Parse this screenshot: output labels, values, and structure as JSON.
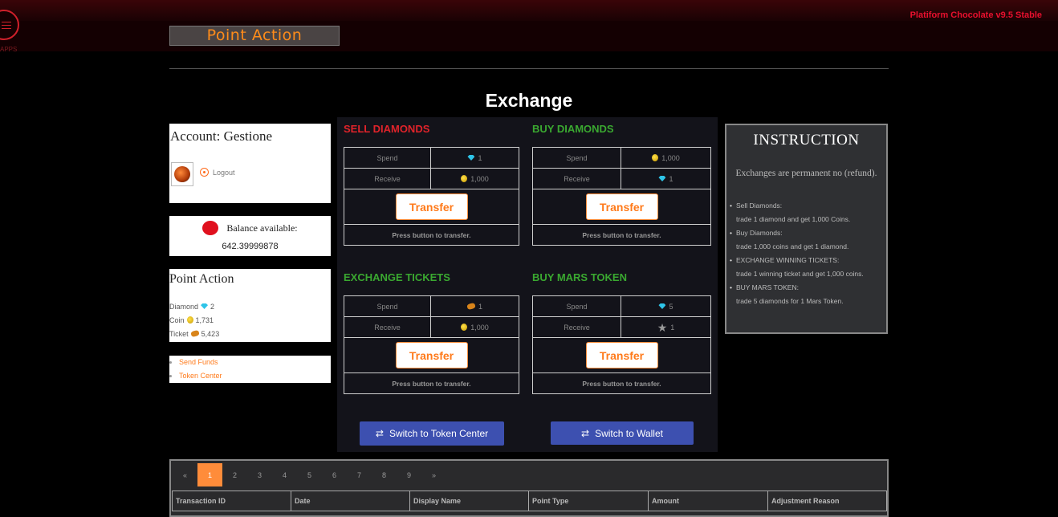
{
  "header": {
    "version": "Platiform Chocolate v9.5 Stable",
    "apps_label": "APPS",
    "logo": "Point Action"
  },
  "page_title": "Exchange",
  "account": {
    "title": "Account: Gestione",
    "logout": "Logout"
  },
  "balance": {
    "label": "Balance available:",
    "value": "642.39999878"
  },
  "point_action": {
    "title": "Point Action",
    "items": [
      {
        "label": "Diamond",
        "icon": "diamond-icon",
        "value": "2"
      },
      {
        "label": "Coin",
        "icon": "coin-icon",
        "value": "1,731"
      },
      {
        "label": "Ticket",
        "icon": "ticket-icon",
        "value": "5,423"
      }
    ]
  },
  "links": [
    "Send Funds",
    "Token Center"
  ],
  "exchange": {
    "spend_label": "Spend",
    "receive_label": "Receive",
    "button_label": "Transfer",
    "hint": "Press button to transfer.",
    "boxes": [
      {
        "title": "SELL DIAMONDS",
        "color": "#e0232a",
        "spend": "1",
        "spend_icon": "diamond-icon",
        "receive": "1,000",
        "receive_icon": "coin-icon"
      },
      {
        "title": "BUY DIAMONDS",
        "color": "#3aa830",
        "spend": "1,000",
        "spend_icon": "coin-icon",
        "receive": "1",
        "receive_icon": "diamond-icon"
      },
      {
        "title": "EXCHANGE TICKETS",
        "color": "#3aa830",
        "spend": "1",
        "spend_icon": "ticket-icon",
        "receive": "1,000",
        "receive_icon": "coin-icon"
      },
      {
        "title": "BUY MARS TOKEN",
        "color": "#3aa830",
        "spend": "5",
        "spend_icon": "diamond-icon",
        "receive": "1",
        "receive_icon": "star-icon"
      }
    ],
    "switch_token": "Switch to Token Center",
    "switch_wallet": "Switch to Wallet"
  },
  "instruction": {
    "title": "INSTRUCTION",
    "note": "Exchanges are permanent no (refund).",
    "items": [
      {
        "head": "Sell Diamonds:",
        "body": "trade 1 diamond and get 1,000 Coins."
      },
      {
        "head": "Buy Diamonds:",
        "body": "trade 1,000 coins and get 1 diamond."
      },
      {
        "head": "EXCHANGE WINNING TICKETS:",
        "body": "trade 1 winning ticket and get 1,000 coins."
      },
      {
        "head": "BUY MARS TOKEN:",
        "body": "trade 5 diamonds for 1 Mars Token."
      }
    ]
  },
  "pagination": {
    "prev": "«",
    "pages": [
      "1",
      "2",
      "3",
      "4",
      "5",
      "6",
      "7",
      "8",
      "9"
    ],
    "next": "»",
    "active": "1"
  },
  "table": {
    "columns": [
      "Transaction ID",
      "Date",
      "Display Name",
      "Point Type",
      "Amount",
      "Adjustment Reason"
    ]
  },
  "colors": {
    "accent": "#ff8c3a",
    "danger": "#e0232a",
    "success": "#3aa830",
    "button_blue": "#3d50b0"
  }
}
